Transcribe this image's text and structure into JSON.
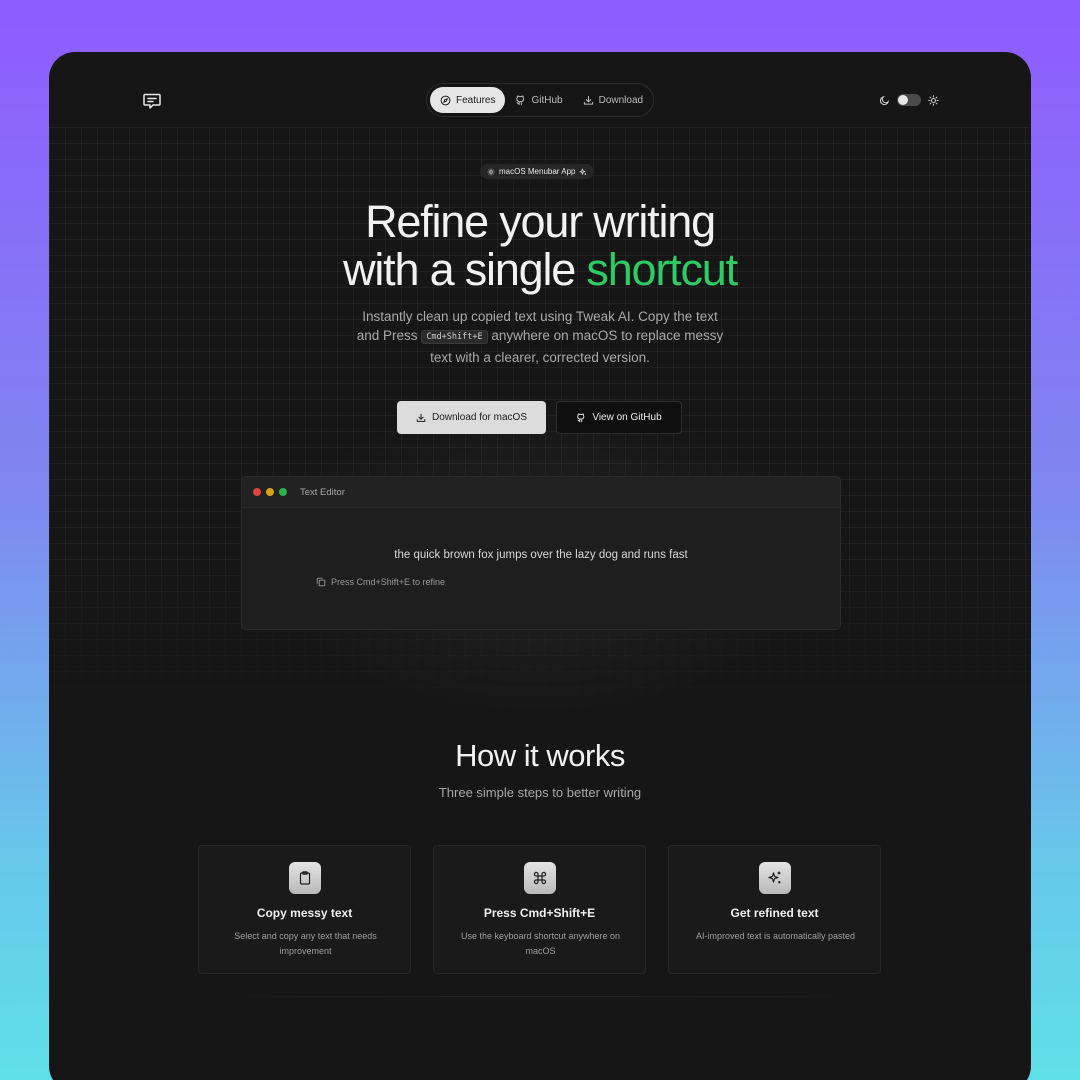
{
  "nav": {
    "items": [
      {
        "label": "Features",
        "icon": "compass-icon",
        "active": true
      },
      {
        "label": "GitHub",
        "icon": "github-icon",
        "active": false
      },
      {
        "label": "Download",
        "icon": "download-icon",
        "active": false
      }
    ]
  },
  "theme": {
    "dark_icon": "moon-icon",
    "light_icon": "sun-icon",
    "toggle_state": "dark"
  },
  "hero": {
    "badge": "macOS Menubar App",
    "title_line1": "Refine your writing",
    "title_line2_prefix": "with a single ",
    "title_accent": "shortcut",
    "subtitle_part1": "Instantly clean up copied text using Tweak AI. Copy the text and Press ",
    "shortcut_kbd": "Cmd+Shift+E",
    "subtitle_part2": " anywhere on macOS to replace messy text with a clearer, corrected version.",
    "primary_button": "Download for macOS",
    "secondary_button": "View on GitHub",
    "accent_color": "#2ecc64"
  },
  "editor": {
    "title": "Text Editor",
    "content": "the quick brown fox jumps over the lazy dog and runs fast",
    "hint": "Press Cmd+Shift+E to refine",
    "dots": [
      "#e0443e",
      "#d6a020",
      "#2bb24c"
    ]
  },
  "how": {
    "title": "How it works",
    "subtitle": "Three simple steps to better writing",
    "steps": [
      {
        "icon": "clipboard-icon",
        "title": "Copy messy text",
        "desc": "Select and copy any text that needs improvement"
      },
      {
        "icon": "command-key-icon",
        "title": "Press Cmd+Shift+E",
        "desc": "Use the keyboard shortcut anywhere on macOS"
      },
      {
        "icon": "sparkles-icon",
        "title": "Get refined text",
        "desc": "AI-improved text is automatically pasted"
      }
    ]
  }
}
